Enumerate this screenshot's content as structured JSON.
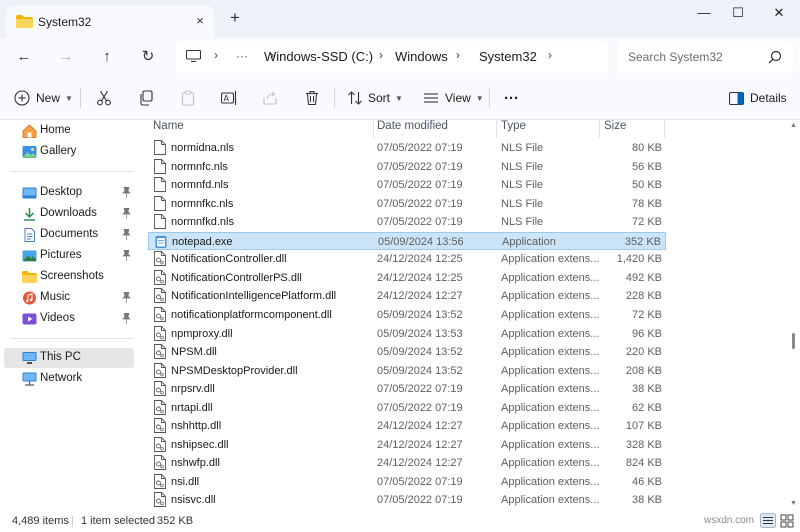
{
  "window": {
    "tab_title": "System32",
    "new_tab": "+",
    "tab_close": "×",
    "minimize": "—",
    "maximize": "☐",
    "close": "✕"
  },
  "address": {
    "more": "···",
    "crumbs": [
      "Windows-SSD (C:)",
      "Windows",
      "System32"
    ],
    "separator": "›",
    "search_placeholder": "Search System32"
  },
  "toolbar": {
    "new_label": "New",
    "sort_label": "Sort",
    "view_label": "View",
    "more_label": "···",
    "details_label": "Details"
  },
  "nav": {
    "home": "Home",
    "gallery": "Gallery",
    "desktop": "Desktop",
    "downloads": "Downloads",
    "documents": "Documents",
    "pictures": "Pictures",
    "screenshots": "Screenshots",
    "music": "Music",
    "videos": "Videos",
    "this_pc": "This PC",
    "network": "Network"
  },
  "columns": {
    "name": "Name",
    "date_modified": "Date modified",
    "type": "Type",
    "size": "Size"
  },
  "files": [
    {
      "name": "normidna.nls",
      "date": "07/05/2022 07:19",
      "type": "NLS File",
      "size": "80 KB"
    },
    {
      "name": "normnfc.nls",
      "date": "07/05/2022 07:19",
      "type": "NLS File",
      "size": "56 KB"
    },
    {
      "name": "normnfd.nls",
      "date": "07/05/2022 07:19",
      "type": "NLS File",
      "size": "50 KB"
    },
    {
      "name": "normnfkc.nls",
      "date": "07/05/2022 07:19",
      "type": "NLS File",
      "size": "78 KB"
    },
    {
      "name": "normnfkd.nls",
      "date": "07/05/2022 07:19",
      "type": "NLS File",
      "size": "72 KB"
    },
    {
      "name": "notepad.exe",
      "date": "05/09/2024 13:56",
      "type": "Application",
      "size": "352 KB"
    },
    {
      "name": "NotificationController.dll",
      "date": "24/12/2024 12:25",
      "type": "Application extens...",
      "size": "1,420 KB"
    },
    {
      "name": "NotificationControllerPS.dll",
      "date": "24/12/2024 12:25",
      "type": "Application extens...",
      "size": "492 KB"
    },
    {
      "name": "NotificationIntelligencePlatform.dll",
      "date": "24/12/2024 12:27",
      "type": "Application extens...",
      "size": "228 KB"
    },
    {
      "name": "notificationplatformcomponent.dll",
      "date": "05/09/2024 13:52",
      "type": "Application extens...",
      "size": "72 KB"
    },
    {
      "name": "npmproxy.dll",
      "date": "05/09/2024 13:53",
      "type": "Application extens...",
      "size": "96 KB"
    },
    {
      "name": "NPSM.dll",
      "date": "05/09/2024 13:52",
      "type": "Application extens...",
      "size": "220 KB"
    },
    {
      "name": "NPSMDesktopProvider.dll",
      "date": "05/09/2024 13:52",
      "type": "Application extens...",
      "size": "208 KB"
    },
    {
      "name": "nrpsrv.dll",
      "date": "07/05/2022 07:19",
      "type": "Application extens...",
      "size": "38 KB"
    },
    {
      "name": "nrtapi.dll",
      "date": "07/05/2022 07:19",
      "type": "Application extens...",
      "size": "62 KB"
    },
    {
      "name": "nshhttp.dll",
      "date": "24/12/2024 12:27",
      "type": "Application extens...",
      "size": "107 KB"
    },
    {
      "name": "nshipsec.dll",
      "date": "24/12/2024 12:27",
      "type": "Application extens...",
      "size": "328 KB"
    },
    {
      "name": "nshwfp.dll",
      "date": "24/12/2024 12:27",
      "type": "Application extens...",
      "size": "824 KB"
    },
    {
      "name": "nsi.dll",
      "date": "07/05/2022 07:19",
      "type": "Application extens...",
      "size": "46 KB"
    },
    {
      "name": "nsisvc.dll",
      "date": "07/05/2022 07:19",
      "type": "Application extens...",
      "size": "38 KB"
    }
  ],
  "selected_file": "notepad.exe",
  "status": {
    "item_count": "4,489 items",
    "selection": "1 item selected",
    "selection_size": "352 KB"
  },
  "watermark": "wsxdn.com",
  "colors": {
    "accent": "#0067c0",
    "selection_bg": "#cce4f7",
    "selection_border": "#99c9ef",
    "folder_yellow": "#f7c843"
  }
}
